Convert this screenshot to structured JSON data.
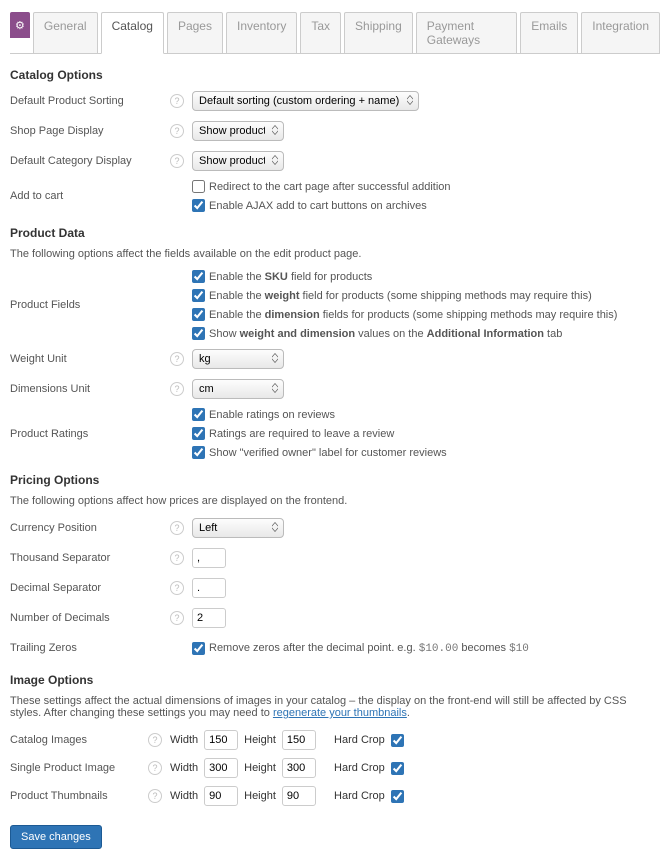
{
  "tabs": {
    "gear": "⚙",
    "items": [
      "General",
      "Catalog",
      "Pages",
      "Inventory",
      "Tax",
      "Shipping",
      "Payment Gateways",
      "Emails",
      "Integration"
    ],
    "active": 1
  },
  "help": "?",
  "s1": {
    "title": "Catalog Options",
    "sort": {
      "lbl": "Default Product Sorting",
      "val": "Default sorting (custom ordering + name)"
    },
    "shop": {
      "lbl": "Shop Page Display",
      "val": "Show products"
    },
    "cat": {
      "lbl": "Default Category Display",
      "val": "Show products"
    },
    "cart": {
      "lbl": "Add to cart",
      "c1": "Redirect to the cart page after successful addition",
      "c2": "Enable AJAX add to cart buttons on archives"
    }
  },
  "s2": {
    "title": "Product Data",
    "desc": "The following options affect the fields available on the edit product page.",
    "fields": {
      "lbl": "Product Fields",
      "a1": "Enable the ",
      "a1b": "SKU",
      "a1c": " field for products",
      "b1": "Enable the ",
      "b1b": "weight",
      "b1c": " field for products (some shipping methods may require this)",
      "c1": "Enable the ",
      "c1b": "dimension",
      "c1c": " fields for products (some shipping methods may require this)",
      "d1": "Show ",
      "d1b": "weight and dimension",
      "d1c": " values on the ",
      "d1d": "Additional Information",
      "d1e": " tab"
    },
    "weight": {
      "lbl": "Weight Unit",
      "val": "kg"
    },
    "dim": {
      "lbl": "Dimensions Unit",
      "val": "cm"
    },
    "ratings": {
      "lbl": "Product Ratings",
      "c1": "Enable ratings on reviews",
      "c2": "Ratings are required to leave a review",
      "c3": "Show \"verified owner\" label for customer reviews"
    }
  },
  "s3": {
    "title": "Pricing Options",
    "desc": "The following options affect how prices are displayed on the frontend.",
    "pos": {
      "lbl": "Currency Position",
      "val": "Left"
    },
    "thou": {
      "lbl": "Thousand Separator",
      "val": ","
    },
    "dec": {
      "lbl": "Decimal Separator",
      "val": "."
    },
    "num": {
      "lbl": "Number of Decimals",
      "val": "2"
    },
    "trail": {
      "lbl": "Trailing Zeros",
      "t1": "Remove zeros after the decimal point. e.g. ",
      "code1": "$10.00",
      "t2": " becomes ",
      "code2": "$10"
    }
  },
  "s4": {
    "title": "Image Options",
    "desc1": "These settings affect the actual dimensions of images in your catalog – the display on the front-end will still be affected by CSS styles. After changing these settings you may need to ",
    "link": "regenerate your thumbnails",
    "desc2": ".",
    "wl": "Width",
    "hl": "Height",
    "hc": "Hard Crop",
    "cat": {
      "lbl": "Catalog Images",
      "w": "150",
      "h": "150"
    },
    "single": {
      "lbl": "Single Product Image",
      "w": "300",
      "h": "300"
    },
    "thumb": {
      "lbl": "Product Thumbnails",
      "w": "90",
      "h": "90"
    }
  },
  "save": "Save changes"
}
